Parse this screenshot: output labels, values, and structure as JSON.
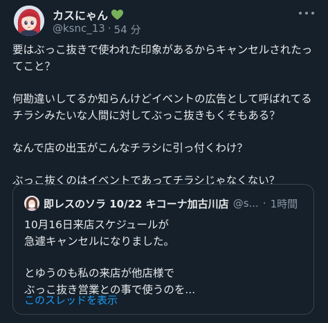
{
  "author": {
    "display_name": "カスにゃん",
    "handle": "@ksnc_13",
    "separator": "·",
    "time": "54 分",
    "avatar_icon": "anime-girl-avatar-icon",
    "badge_icon": "green-heart-icon"
  },
  "tweet": {
    "paragraphs": [
      "要はぶっこ抜きで使われた印象があるからキャンセルされたってこと？",
      "何勘違いしてるか知らんけどイベントの広告として呼ばれてるチラシみたいな人間に対してぶっこ抜きもくそもある？",
      "なんで店の出玉がこんなチラシに引っ付くわけ？",
      "ぶっこ抜くのはイベントであってチラシじゃなくない？"
    ]
  },
  "quote": {
    "display_name": "即レスのソラ 10/22 キコーナ加古川店",
    "handle": "@s...",
    "separator": "·",
    "time": "1時間",
    "avatar_icon": "quoted-user-avatar-icon",
    "paragraphs": [
      "10月16日来店スケジュールが\n急遽キャンセルになりました。",
      "とゆうのも私の来店が他店様で\nぶっこ抜き営業との事で使うのを..."
    ],
    "show_thread_label": "このスレッドを表示"
  },
  "colors": {
    "background": "#15202b",
    "text_primary": "#e7e9ea",
    "text_secondary": "#8b98a5",
    "link": "#1d9bf0",
    "border": "#38444d",
    "heart": "#78b159"
  }
}
